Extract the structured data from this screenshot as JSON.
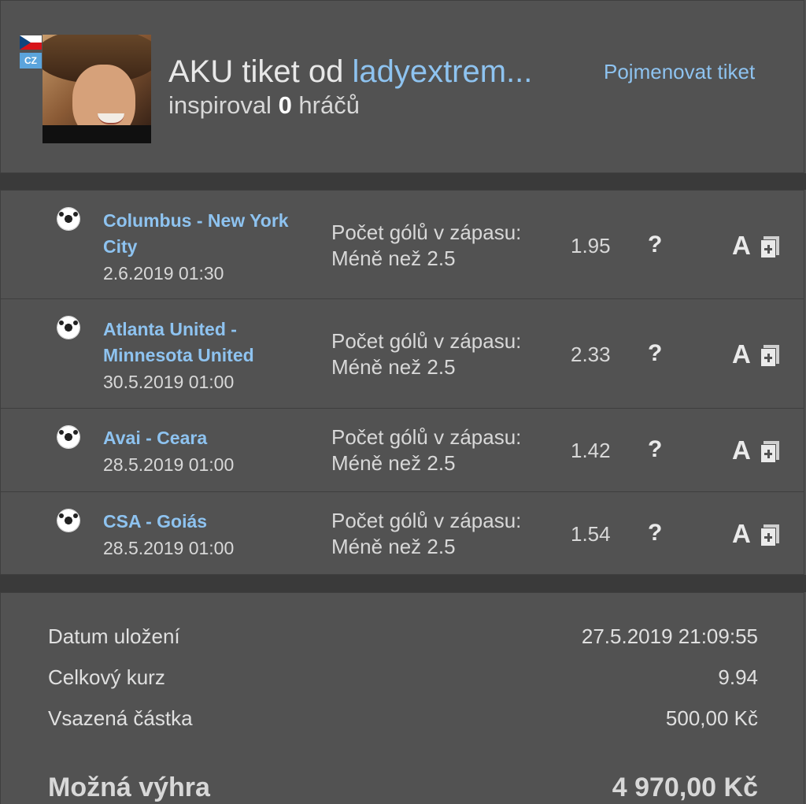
{
  "header": {
    "flag_label": "CZ",
    "title_prefix": "AKU tiket od ",
    "username": "ladyextrem...",
    "rename_link": "Pojmenovat tiket",
    "inspired_prefix": "inspiroval ",
    "inspired_count": "0",
    "inspired_suffix": " hráčů"
  },
  "bets": [
    {
      "match_line1": "Columbus - New York",
      "match_line2": "City",
      "date": "2.6.2019 01:30",
      "market_line1": "Počet gólů v zápasu:",
      "market_line2": "Méně než 2.5",
      "odds": "1.95",
      "help": "?",
      "a_label": "A"
    },
    {
      "match_line1": "Atlanta United -",
      "match_line2": "Minnesota United",
      "date": "30.5.2019 01:00",
      "market_line1": "Počet gólů v zápasu:",
      "market_line2": "Méně než 2.5",
      "odds": "2.33",
      "help": "?",
      "a_label": "A"
    },
    {
      "match_line1": "Avai - Ceara",
      "match_line2": "",
      "date": "28.5.2019 01:00",
      "market_line1": "Počet gólů v zápasu:",
      "market_line2": "Méně než 2.5",
      "odds": "1.42",
      "help": "?",
      "a_label": "A"
    },
    {
      "match_line1": "CSA - Goiás",
      "match_line2": "",
      "date": "28.5.2019 01:00",
      "market_line1": "Počet gólů v zápasu:",
      "market_line2": "Méně než 2.5",
      "odds": "1.54",
      "help": "?",
      "a_label": "A"
    }
  ],
  "summary": {
    "saved_label": "Datum uložení",
    "saved_value": "27.5.2019 21:09:55",
    "total_odds_label": "Celkový kurz",
    "total_odds_value": "9.94",
    "stake_label": "Vsazená částka",
    "stake_value": "500,00 Kč",
    "win_label": "Možná výhra",
    "win_value": "4 970,00 Kč"
  },
  "colors": {
    "background": "#525252",
    "separator": "#3a3a3a",
    "link": "#8ec3f0",
    "text": "#d8d8d8"
  }
}
